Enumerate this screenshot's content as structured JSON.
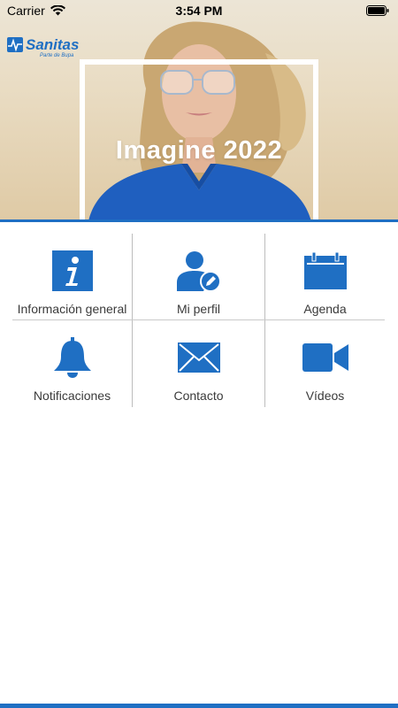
{
  "status_bar": {
    "carrier": "Carrier",
    "time": "3:54 PM"
  },
  "hero": {
    "title": "Imagine 2022"
  },
  "logo": {
    "brand": "Sanitas",
    "tagline": "Parte de Bupa"
  },
  "colors": {
    "accent": "#1f6fc3",
    "divider": "#bdbdbd"
  },
  "menu": [
    {
      "label": "Información general",
      "icon": "info-icon"
    },
    {
      "label": "Mi perfil",
      "icon": "profile-edit-icon"
    },
    {
      "label": "Agenda",
      "icon": "calendar-icon"
    },
    {
      "label": "Notificaciones",
      "icon": "bell-icon"
    },
    {
      "label": "Contacto",
      "icon": "envelope-icon"
    },
    {
      "label": "Vídeos",
      "icon": "video-camera-icon"
    }
  ]
}
